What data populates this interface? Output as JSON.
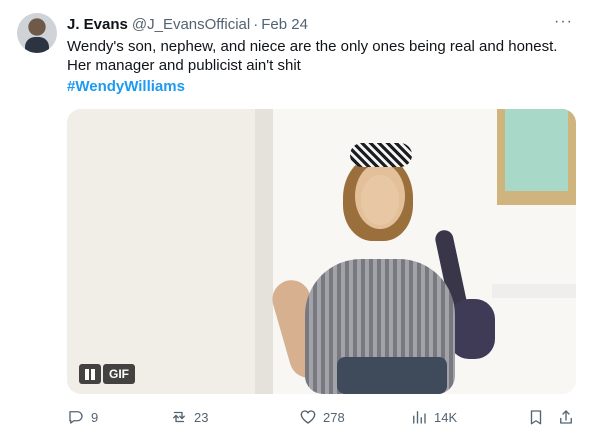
{
  "tweet": {
    "name": "J. Evans",
    "handle": "@J_EvansOfficial",
    "separator": "·",
    "date": "Feb 24",
    "more_label": "···",
    "text_line_1": "Wendy's son, nephew, and niece are the only ones being real and honest.",
    "text_line_2": "Her manager and publicist ain't shit",
    "hashtag": "#WendyWilliams",
    "media_badge": "GIF"
  },
  "actions": {
    "replies": "9",
    "retweets": "23",
    "likes": "278",
    "views": "14K"
  },
  "icons": {
    "avatar": "profile-avatar",
    "more": "more-icon",
    "reply": "reply-icon",
    "retweet": "retweet-icon",
    "like": "heart-icon",
    "views": "analytics-icon",
    "bookmark": "bookmark-icon",
    "share": "share-icon",
    "pause": "pause-icon"
  },
  "colors": {
    "link": "#1d9bf0",
    "secondary_text": "#536471",
    "primary_text": "#0f1419",
    "background": "#ffffff"
  }
}
